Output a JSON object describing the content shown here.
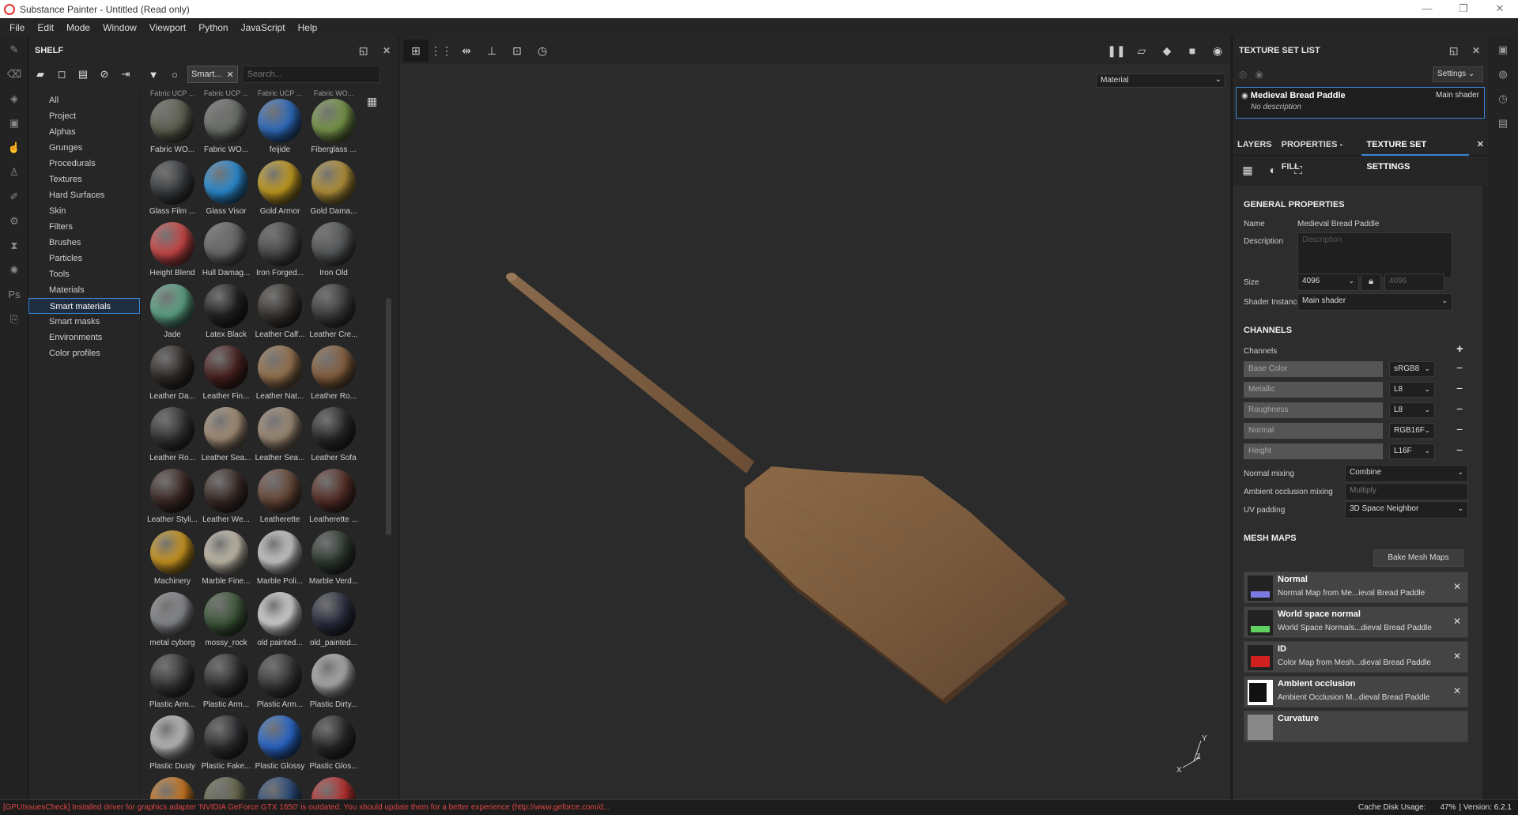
{
  "window": {
    "title": "Substance Painter - Untitled (Read only)",
    "buttons": [
      "—",
      "❐",
      "✕"
    ]
  },
  "menu": [
    "File",
    "Edit",
    "Mode",
    "Window",
    "Viewport",
    "Python",
    "JavaScript",
    "Help"
  ],
  "shelf": {
    "title": "SHELF",
    "filter_chip": "Smart...",
    "search_placeholder": "Search...",
    "categories": [
      "All",
      "Project",
      "Alphas",
      "Grunges",
      "Procedurals",
      "Textures",
      "Hard Surfaces",
      "Skin",
      "Filters",
      "Brushes",
      "Particles",
      "Tools",
      "Materials",
      "Smart materials",
      "Smart masks",
      "Environments",
      "Color profiles"
    ],
    "selected_category": "Smart materials",
    "top_partial_labels": [
      "Fabric UCP ...",
      "Fabric UCP ...",
      "Fabric UCP ...",
      "Fabric WO..."
    ],
    "items": [
      {
        "label": "Fabric WO...",
        "color": "#5e6352"
      },
      {
        "label": "Fabric WO...",
        "color": "#6e726c"
      },
      {
        "label": "feijide",
        "color": "#2f6fc4"
      },
      {
        "label": "Fiberglass ...",
        "color": "#7a9a4a"
      },
      {
        "label": "Glass Film ...",
        "color": "#3a3d40"
      },
      {
        "label": "Glass Visor",
        "color": "#2a8fd8"
      },
      {
        "label": "Gold Armor",
        "color": "#c8a020"
      },
      {
        "label": "Gold Dama...",
        "color": "#b8953a"
      },
      {
        "label": "Height Blend",
        "color": "#d04848"
      },
      {
        "label": "Hull Damag...",
        "color": "#6a6a6a"
      },
      {
        "label": "Iron Forged...",
        "color": "#4a4b4d"
      },
      {
        "label": "Iron Old",
        "color": "#555759"
      },
      {
        "label": "Jade",
        "color": "#5fa88a"
      },
      {
        "label": "Latex Black",
        "color": "#222222"
      },
      {
        "label": "Leather Calf...",
        "color": "#3a3530"
      },
      {
        "label": "Leather Cre...",
        "color": "#3e3d3c"
      },
      {
        "label": "Leather Da...",
        "color": "#322c29"
      },
      {
        "label": "Leather Fin...",
        "color": "#4a2220"
      },
      {
        "label": "Leather Nat...",
        "color": "#9a7650"
      },
      {
        "label": "Leather Ro...",
        "color": "#8a6240"
      },
      {
        "label": "Leather Ro...",
        "color": "#353535"
      },
      {
        "label": "Leather Sea...",
        "color": "#a8927a"
      },
      {
        "label": "Leather Sea...",
        "color": "#a28e78"
      },
      {
        "label": "Leather Sofa",
        "color": "#2a2a2a"
      },
      {
        "label": "Leather Styli...",
        "color": "#3e2a26"
      },
      {
        "label": "Leather We...",
        "color": "#3d2c28"
      },
      {
        "label": "Leatherette",
        "color": "#6a4a3a"
      },
      {
        "label": "Leatherette ...",
        "color": "#5a3028"
      },
      {
        "label": "Machinery",
        "color": "#d09a20"
      },
      {
        "label": "Marble Fine...",
        "color": "#c8c2b0"
      },
      {
        "label": "Marble Poli...",
        "color": "#cfcfcf"
      },
      {
        "label": "Marble Verd...",
        "color": "#2e3a30"
      },
      {
        "label": "metal cyborg",
        "color": "#8a8c90"
      },
      {
        "label": "mossy_rock",
        "color": "#3e5a3a"
      },
      {
        "label": "old painted...",
        "color": "#dadada"
      },
      {
        "label": "old_painted...",
        "color": "#2a2e40"
      },
      {
        "label": "Plastic Arm...",
        "color": "#38383a"
      },
      {
        "label": "Plastic Arm...",
        "color": "#323234"
      },
      {
        "label": "Plastic Arm...",
        "color": "#3a3a3c"
      },
      {
        "label": "Plastic Dirty...",
        "color": "#b0b0b0"
      },
      {
        "label": "Plastic Dusty",
        "color": "#c0c0c0"
      },
      {
        "label": "Plastic Fake...",
        "color": "#2e2f31"
      },
      {
        "label": "Plastic Glossy",
        "color": "#2a6ad0"
      },
      {
        "label": "Plastic Glos...",
        "color": "#2a2a2a"
      }
    ],
    "bottom_partial_colors": [
      "#d07a20",
      "#6a6a50",
      "#2a4a7a",
      "#c03030"
    ]
  },
  "viewport": {
    "material_select": "Material",
    "axis_labels": {
      "x": "X",
      "y": "Y",
      "z": "Z"
    }
  },
  "texture_set_list": {
    "title": "TEXTURE SET LIST",
    "settings_label": "Settings",
    "item_name": "Medieval Bread Paddle",
    "item_shader": "Main shader",
    "item_description": "No description"
  },
  "tabs": {
    "layers": "LAYERS",
    "properties": "PROPERTIES - FILL",
    "texture_set_settings": "TEXTURE SET SETTINGS"
  },
  "general": {
    "heading": "GENERAL PROPERTIES",
    "name_label": "Name",
    "name_value": "Medieval Bread Paddle",
    "description_label": "Description",
    "description_placeholder": "Description",
    "size_label": "Size",
    "size_value": "4096",
    "size_linked": "4096",
    "shader_label": "Shader Instance",
    "shader_value": "Main shader"
  },
  "channels": {
    "heading": "CHANNELS",
    "label": "Channels",
    "list": [
      {
        "name": "Base Color",
        "format": "sRGB8"
      },
      {
        "name": "Metallic",
        "format": "L8"
      },
      {
        "name": "Roughness",
        "format": "L8"
      },
      {
        "name": "Normal",
        "format": "RGB16F"
      },
      {
        "name": "Height",
        "format": "L16F"
      }
    ],
    "normal_mixing_label": "Normal mixing",
    "normal_mixing_value": "Combine",
    "ao_mixing_label": "Ambient occlusion mixing",
    "ao_mixing_value": "Multiply",
    "uv_padding_label": "UV padding",
    "uv_padding_value": "3D Space Neighbor"
  },
  "mesh_maps": {
    "heading": "MESH MAPS",
    "bake_label": "Bake Mesh Maps",
    "list": [
      {
        "title": "Normal",
        "desc": "Normal Map from Me...ieval Bread Paddle",
        "icon_color": "#7a7ae0"
      },
      {
        "title": "World space normal",
        "desc": "World Space Normals...dieval Bread Paddle",
        "icon_color": "#60d060"
      },
      {
        "title": "ID",
        "desc": "Color Map from Mesh...dieval Bread Paddle",
        "icon_color": "#d02020"
      },
      {
        "title": "Ambient occlusion",
        "desc": "Ambient Occlusion M...dieval Bread Paddle",
        "icon_color": "#ffffff"
      },
      {
        "title": "Curvature",
        "desc": "",
        "icon_color": "#888888"
      }
    ]
  },
  "status": {
    "error": "[GPUIssuesCheck] Installed driver for graphics adapter 'NVIDIA GeForce GTX 1650' is outdated. You should update them for a better experience (http://www.geforce.com/d...",
    "cache_label": "Cache Disk Usage:",
    "cache_value": "47%",
    "version": "| Version: 6.2.1"
  }
}
